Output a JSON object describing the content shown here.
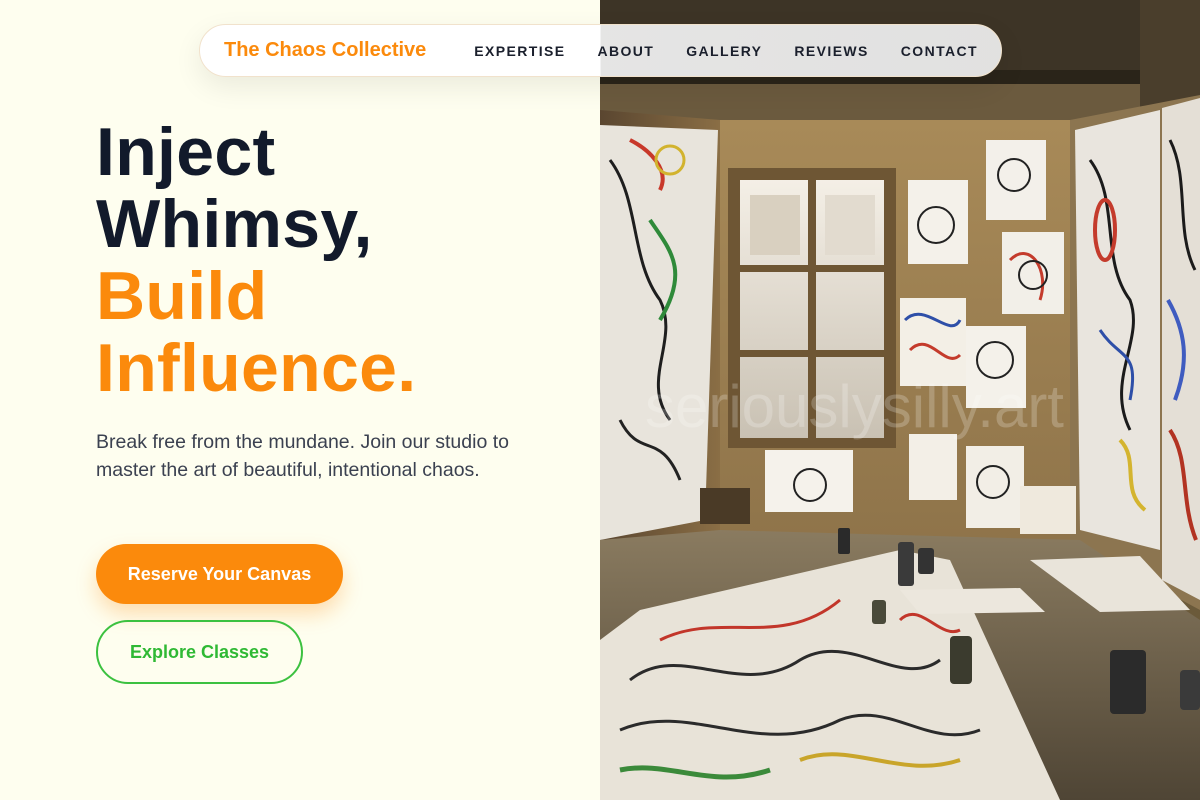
{
  "nav": {
    "brand": "The Chaos Collective",
    "links": [
      "EXPERTISE",
      "ABOUT",
      "GALLERY",
      "REVIEWS",
      "CONTACT"
    ]
  },
  "hero": {
    "title_line1": "Inject",
    "title_line2": "Whimsy,",
    "title_line3": "Build",
    "title_line4": "Influence.",
    "description": "Break free from the mundane. Join our studio to master the art of beautiful, intentional chaos.",
    "primary_button": "Reserve Your Canvas",
    "secondary_button": "Explore Classes"
  },
  "photo": {
    "watermark": "seriouslysilly.art"
  },
  "colors": {
    "accent": "#fb8a0c",
    "dark": "#121a2b",
    "green": "#3cc140",
    "background": "#fefeef"
  }
}
